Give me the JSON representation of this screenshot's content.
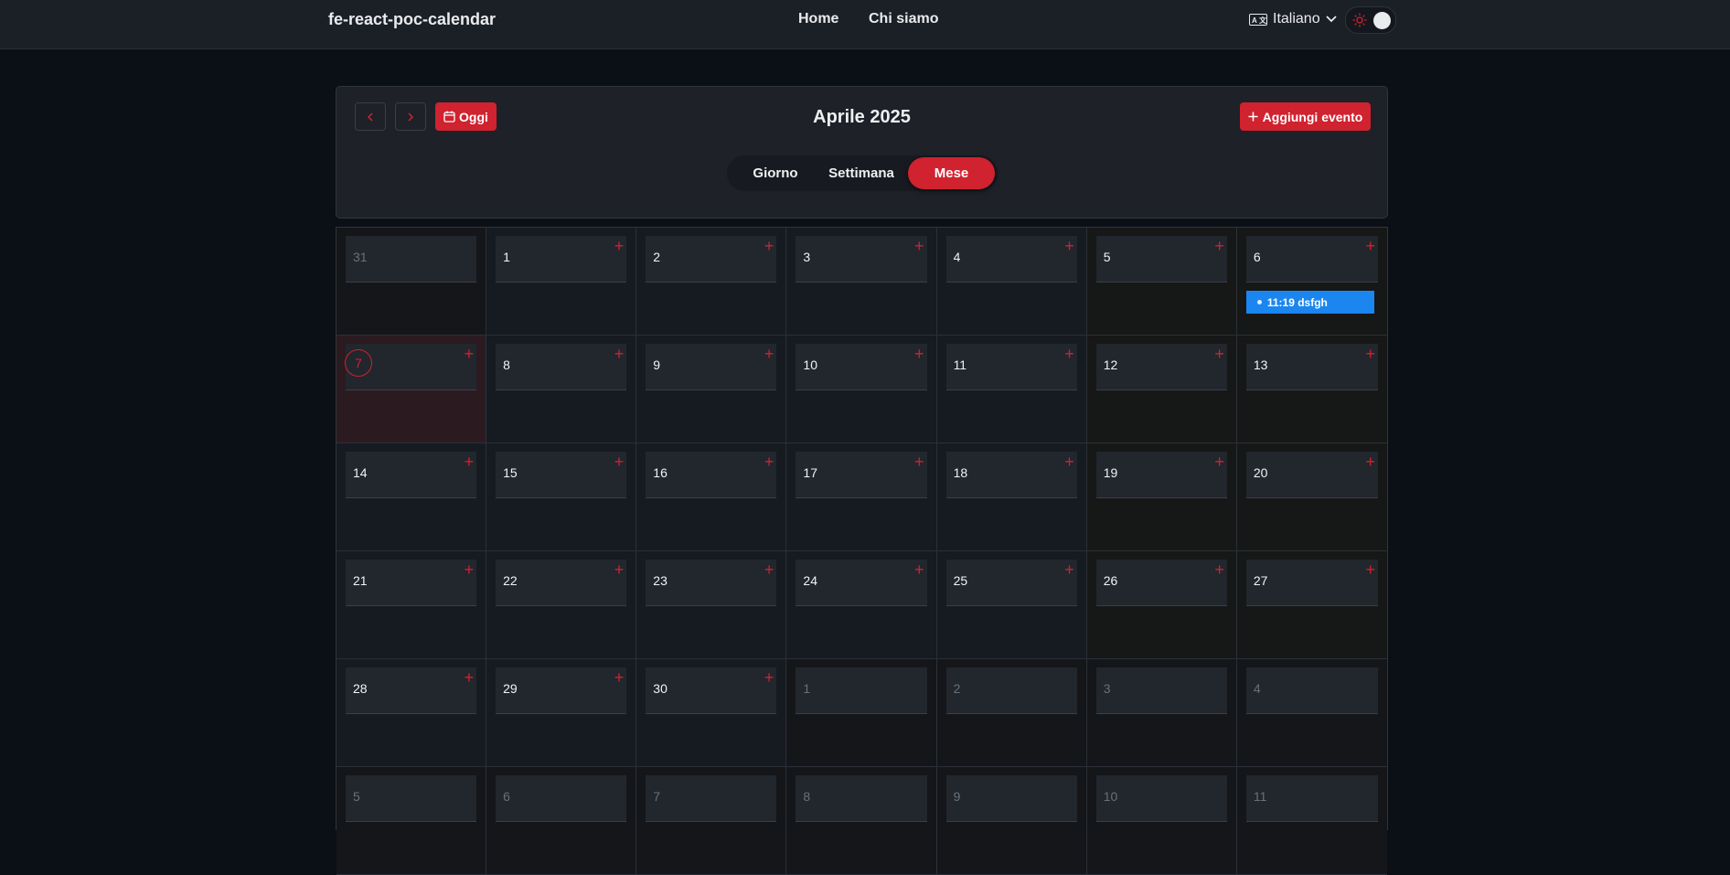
{
  "navbar": {
    "brand": "fe-react-poc-calendar",
    "links": [
      "Home",
      "Chi siamo"
    ],
    "language": "Italiano"
  },
  "calendar": {
    "title": "Aprile 2025",
    "today_label": "Oggi",
    "add_event_label": "Aggiungi evento",
    "views": [
      "Giorno",
      "Settimana",
      "Mese"
    ],
    "active_view": "Mese",
    "accent_color": "#d0222f",
    "event_color": "#1b86f0",
    "days": [
      {
        "n": "31",
        "out": true
      },
      {
        "n": "1"
      },
      {
        "n": "2"
      },
      {
        "n": "3"
      },
      {
        "n": "4"
      },
      {
        "n": "5"
      },
      {
        "n": "6",
        "event": "11:19 dsfgh"
      },
      {
        "n": "7",
        "today": true
      },
      {
        "n": "8"
      },
      {
        "n": "9"
      },
      {
        "n": "10"
      },
      {
        "n": "11"
      },
      {
        "n": "12"
      },
      {
        "n": "13"
      },
      {
        "n": "14"
      },
      {
        "n": "15"
      },
      {
        "n": "16"
      },
      {
        "n": "17"
      },
      {
        "n": "18"
      },
      {
        "n": "19"
      },
      {
        "n": "20"
      },
      {
        "n": "21"
      },
      {
        "n": "22"
      },
      {
        "n": "23"
      },
      {
        "n": "24"
      },
      {
        "n": "25"
      },
      {
        "n": "26"
      },
      {
        "n": "27"
      },
      {
        "n": "28"
      },
      {
        "n": "29"
      },
      {
        "n": "30"
      },
      {
        "n": "1",
        "out": true
      },
      {
        "n": "2",
        "out": true
      },
      {
        "n": "3",
        "out": true
      },
      {
        "n": "4",
        "out": true
      },
      {
        "n": "5",
        "out": true
      },
      {
        "n": "6",
        "out": true
      },
      {
        "n": "7",
        "out": true
      },
      {
        "n": "8",
        "out": true
      },
      {
        "n": "9",
        "out": true
      },
      {
        "n": "10",
        "out": true
      },
      {
        "n": "11",
        "out": true
      }
    ]
  }
}
